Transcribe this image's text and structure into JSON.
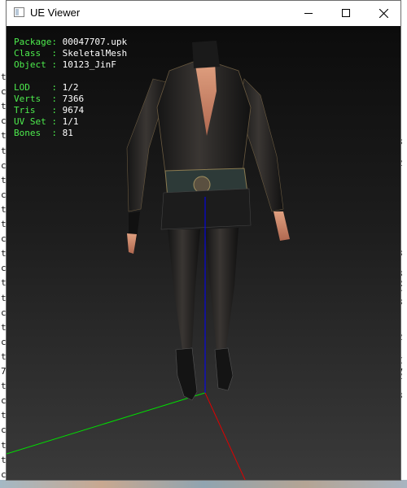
{
  "window": {
    "title": "UE Viewer"
  },
  "info": {
    "package_label": "Package:",
    "package_value": "00047707.upk",
    "class_label": "Class  :",
    "class_value": "SkeletalMesh",
    "object_label": "Object :",
    "object_value": "10123_JinF",
    "lod_label": "LOD    :",
    "lod_value": "1/2",
    "verts_label": "Verts  :",
    "verts_value": "7366",
    "tris_label": "Tris   :",
    "tris_value": "9674",
    "uvset_label": "UV Set :",
    "uvset_value": "1/1",
    "bones_label": "Bones  :",
    "bones_value": "81"
  },
  "background": {
    "left_rows": [
      "t",
      "c",
      "t",
      "c",
      "t",
      "t",
      "c",
      "t",
      "c",
      "t",
      "t",
      "c",
      "t",
      "c",
      "t",
      "t",
      "c",
      "t",
      "c",
      "t",
      "7",
      "t",
      "c",
      "t",
      "c",
      "t",
      "t",
      "c"
    ],
    "right_rows": [
      "3",
      "2",
      "3",
      "3",
      "2",
      "C",
      "3",
      "2",
      "C",
      "V",
      "2",
      "3"
    ]
  },
  "colors": {
    "overlay_label": "#4dec4d",
    "overlay_value": "#ffffff",
    "axis_x": "#ff0000",
    "axis_y": "#00ff00",
    "axis_z": "#0000ff"
  },
  "icons": {
    "app": "window-app-icon",
    "minimize": "minimize-icon",
    "maximize": "maximize-icon",
    "close": "close-icon"
  }
}
